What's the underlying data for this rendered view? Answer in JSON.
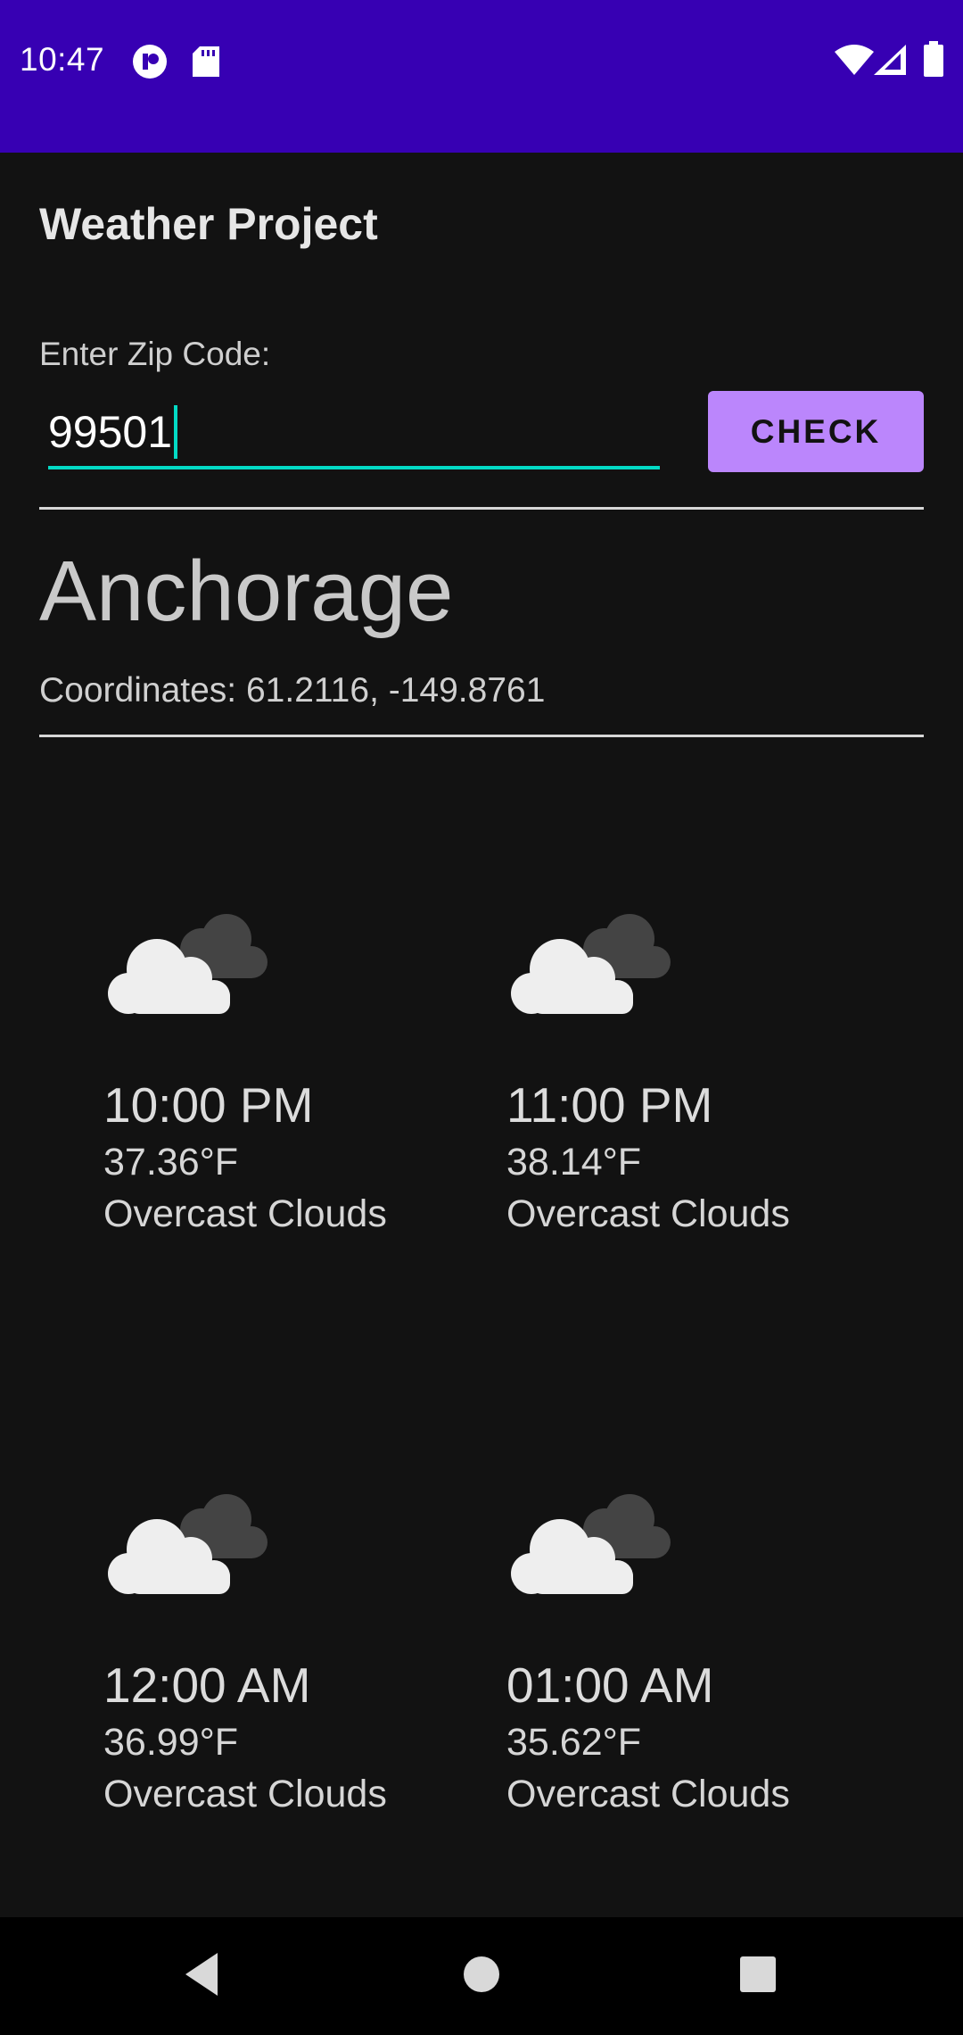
{
  "status_bar": {
    "time": "10:47",
    "icons": [
      "notification-icon",
      "sd-card-icon",
      "wifi-icon",
      "signal-icon",
      "battery-icon"
    ],
    "background_color": "#3700b3"
  },
  "app": {
    "title": "Weather Project"
  },
  "search": {
    "label": "Enter Zip Code:",
    "value": "99501",
    "button_label": "CHECK",
    "accent_color": "#03dac5",
    "button_color": "#bb86fc"
  },
  "location": {
    "city": "Anchorage",
    "coordinates_prefix": "Coordinates:",
    "coordinates_value": "61.2116, -149.8761"
  },
  "forecast": [
    {
      "time": "10:00 PM",
      "temp": "37.36°F",
      "description": "Overcast Clouds",
      "icon": "overcast-clouds-icon"
    },
    {
      "time": "11:00 PM",
      "temp": "38.14°F",
      "description": "Overcast Clouds",
      "icon": "overcast-clouds-icon"
    },
    {
      "time": "12:00 AM",
      "temp": "36.99°F",
      "description": "Overcast Clouds",
      "icon": "overcast-clouds-icon"
    },
    {
      "time": "01:00 AM",
      "temp": "35.62°F",
      "description": "Overcast Clouds",
      "icon": "overcast-clouds-icon"
    }
  ],
  "nav_bar": {
    "buttons": [
      "back-icon",
      "home-icon",
      "recents-icon"
    ]
  }
}
